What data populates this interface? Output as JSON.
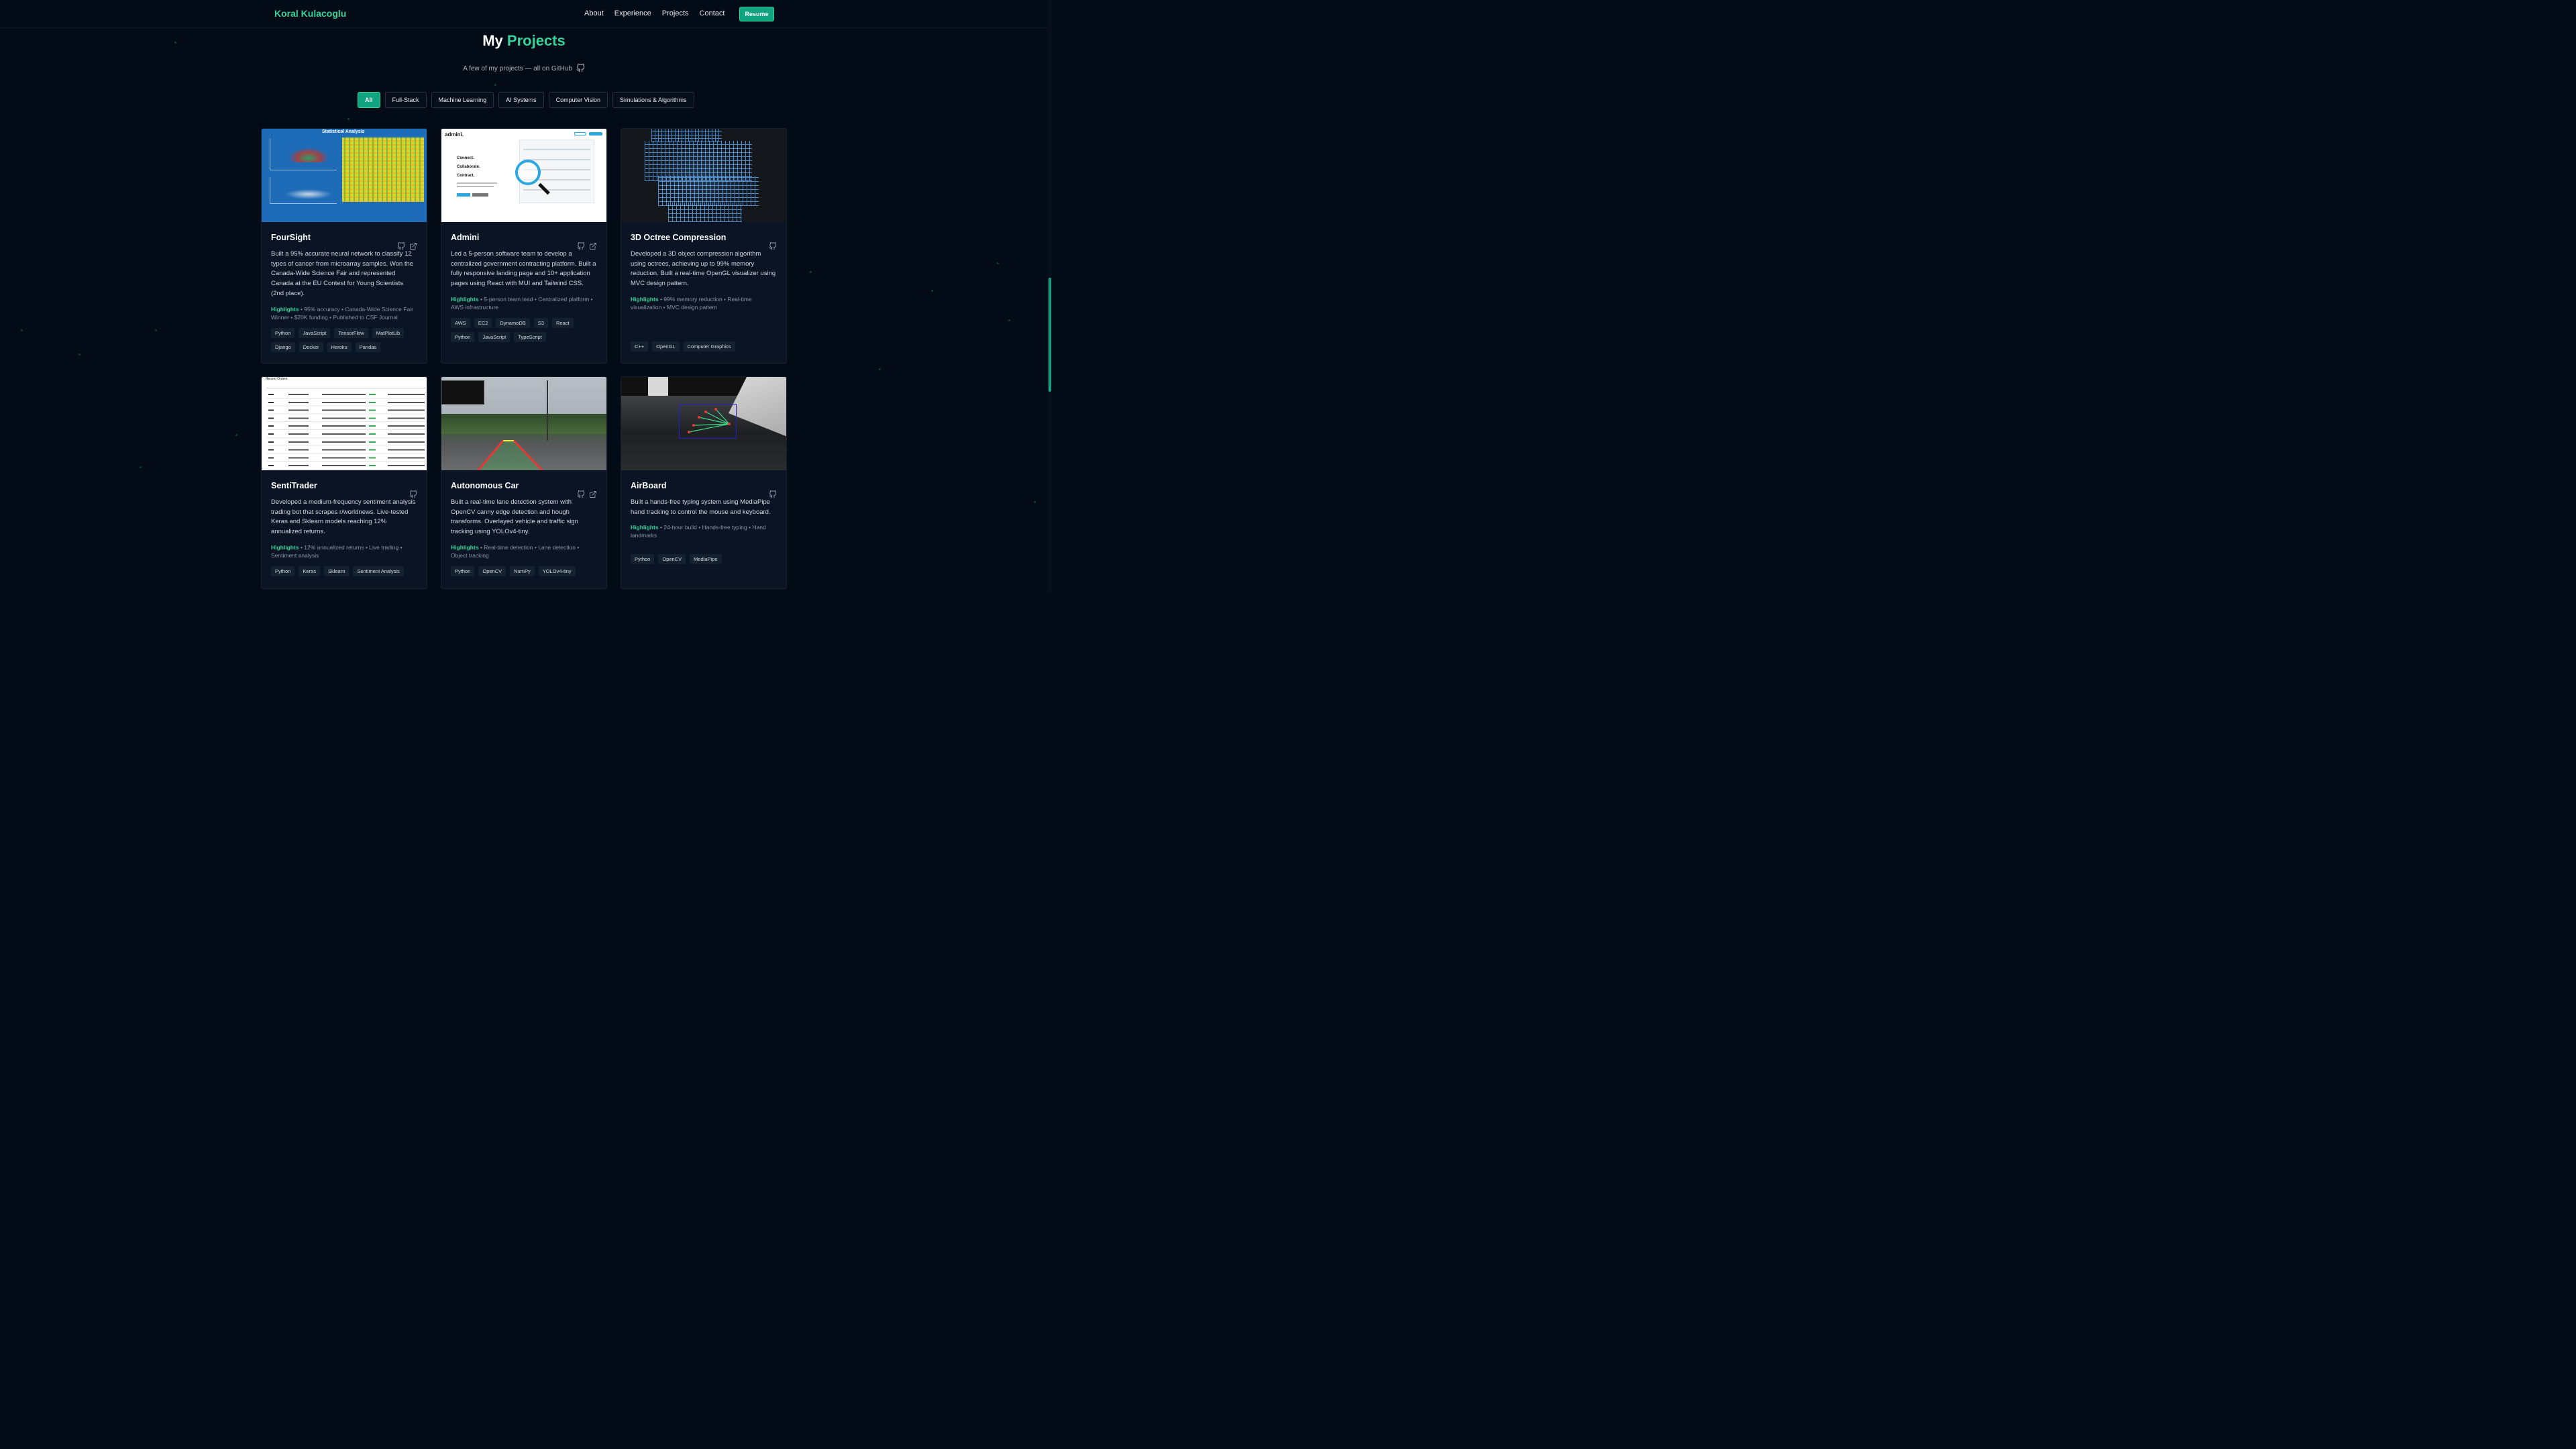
{
  "nav": {
    "brand": "Koral Kulacoglu",
    "links": [
      "About",
      "Experience",
      "Projects",
      "Contact"
    ],
    "resume": "Resume"
  },
  "header": {
    "title_prefix": "My",
    "title_accent": "Projects",
    "subtitle": "A few of my projects — all on GitHub"
  },
  "filters": [
    "All",
    "Full-Stack",
    "Machine Learning",
    "AI Systems",
    "Computer Vision",
    "Simulations & Algorithms"
  ],
  "active_filter": "All",
  "accent_color": "#34d399",
  "projects": [
    {
      "title": "FourSight",
      "description": "Built a 95% accurate neural network to classify 12 types of cancer from microarray samples. Won the Canada-Wide Science Fair and represented Canada at the EU Contest for Young Scientists (2nd place).",
      "highlights_label": "Highlights",
      "highlights": "• 95% accuracy • Canada-Wide Science Fair Winner • $20K funding • Published to CSF Journal",
      "tags": [
        "Python",
        "JavaScript",
        "TensorFlow",
        "MatPlotLib",
        "Django",
        "Docker",
        "Heroku",
        "Pandas"
      ],
      "icons": [
        "github-icon",
        "external-link-icon"
      ],
      "thumb_text": "Statistical Analysis"
    },
    {
      "title": "Admini",
      "description": "Led a 5-person software team to develop a centralized government contracting platform. Built a fully responsive landing page and 10+ application pages using React with MUI and Tailwind CSS.",
      "highlights_label": "Highlights",
      "highlights": "• 5-person team lead • Centralized platform • AWS infrastructure",
      "tags": [
        "AWS",
        "EC2",
        "DynamoDB",
        "S3",
        "React",
        "Python",
        "JavaScript",
        "TypeScript"
      ],
      "icons": [
        "github-icon",
        "external-link-icon"
      ],
      "thumb_text": "admini."
    },
    {
      "title": "3D Octree Compression",
      "description": "Developed a 3D object compression algorithm using octrees, achieving up to 99% memory reduction. Built a real-time OpenGL visualizer using MVC design pattern.",
      "highlights_label": "Highlights",
      "highlights": "• 99% memory reduction • Real-time visualization • MVC design pattern",
      "tags": [
        "C++",
        "OpenGL",
        "Computer Graphics"
      ],
      "icons": [
        "github-icon"
      ]
    },
    {
      "title": "SentiTrader",
      "description": "Developed a medium-frequency sentiment analysis trading bot that scrapes r/worldnews. Live-tested Keras and Sklearn models reaching 12% annualized returns.",
      "highlights_label": "Highlights",
      "highlights": "• 12% annualized returns • Live trading • Sentiment analysis",
      "tags": [
        "Python",
        "Keras",
        "Sklearn",
        "Sentiment Analysis"
      ],
      "icons": [
        "github-icon"
      ],
      "thumb_text": "Recent Orders"
    },
    {
      "title": "Autonomous Car",
      "description": "Built a real-time lane detection system with OpenCV canny edge detection and hough transforms. Overlayed vehicle and traffic sign tracking using YOLOv4-tiny.",
      "highlights_label": "Highlights",
      "highlights": "• Real-time detection • Lane detection • Object tracking",
      "tags": [
        "Python",
        "OpenCV",
        "NumPy",
        "YOLOv4-tiny"
      ],
      "icons": [
        "github-icon",
        "external-link-icon"
      ]
    },
    {
      "title": "AirBoard",
      "description": "Built a hands-free typing system using MediaPipe hand tracking to control the mouse and keyboard.",
      "highlights_label": "Highlights",
      "highlights": "• 24-hour build • Hands-free typing • Hand landmarks",
      "tags": [
        "Python",
        "OpenCV",
        "MediaPipe"
      ],
      "icons": [
        "github-icon"
      ]
    }
  ]
}
